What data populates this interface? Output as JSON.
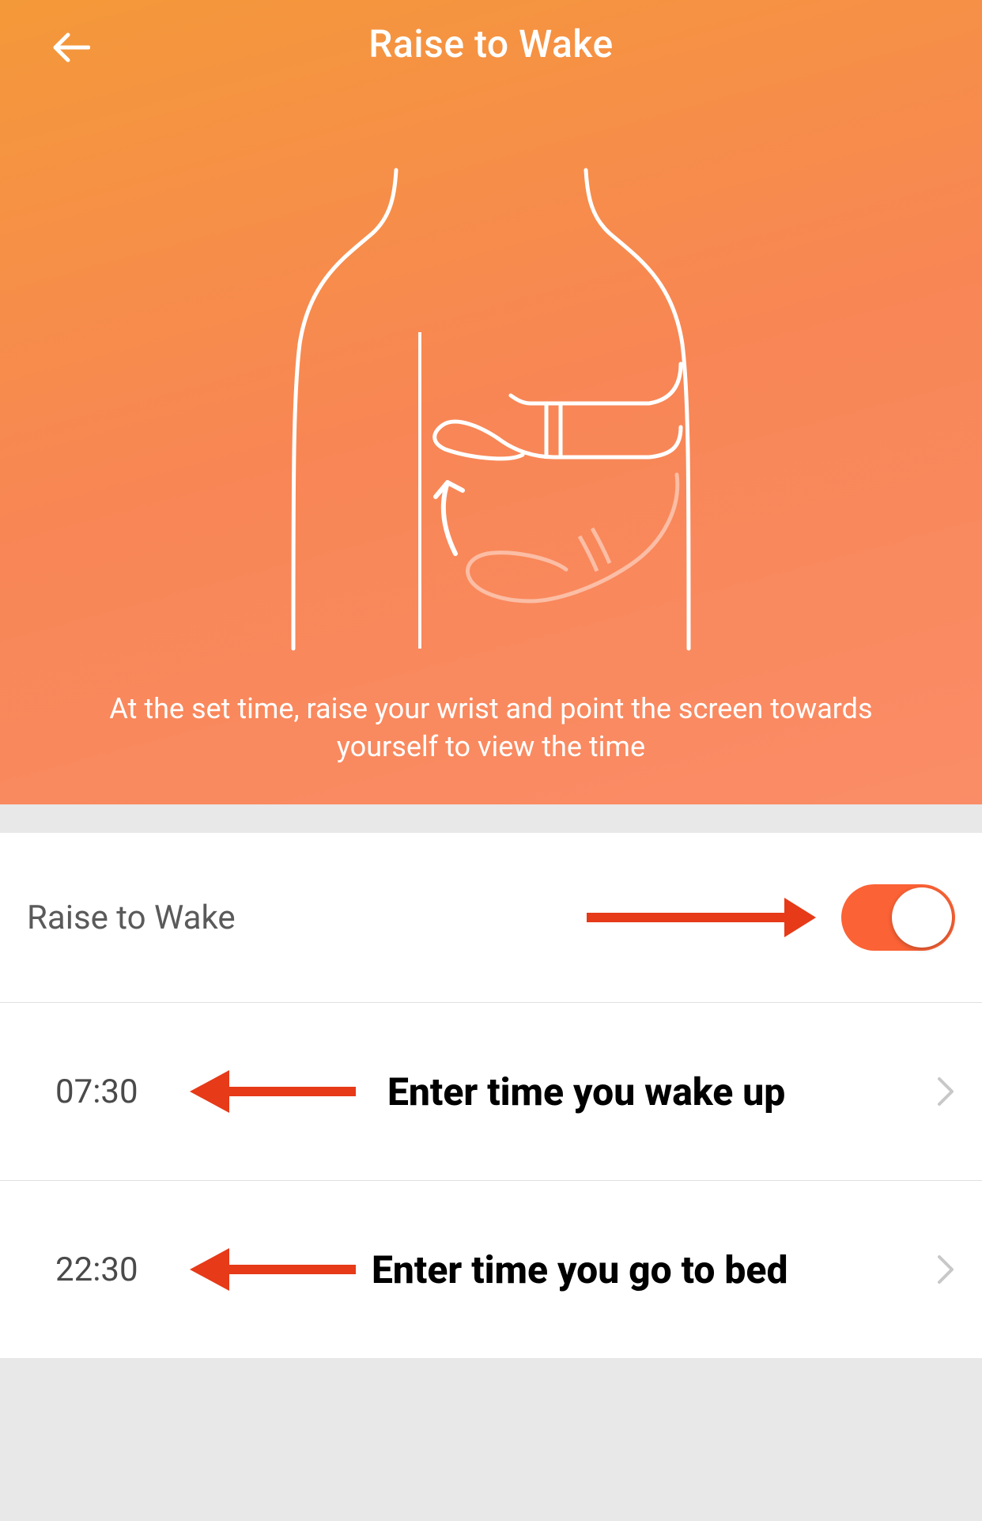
{
  "header": {
    "title": "Raise to Wake"
  },
  "hero": {
    "description": "At the set time, raise your wrist and point the screen towards yourself to view the time"
  },
  "toggle": {
    "label": "Raise to Wake",
    "enabled": true
  },
  "times": {
    "wake": {
      "value": "07:30",
      "label": "Enter time you wake up"
    },
    "bed": {
      "value": "22:30",
      "label": "Enter time you go to bed"
    }
  },
  "colors": {
    "accent": "#fb6235",
    "hero_grad_a": "#f49939",
    "hero_grad_b": "#fa8c67"
  }
}
